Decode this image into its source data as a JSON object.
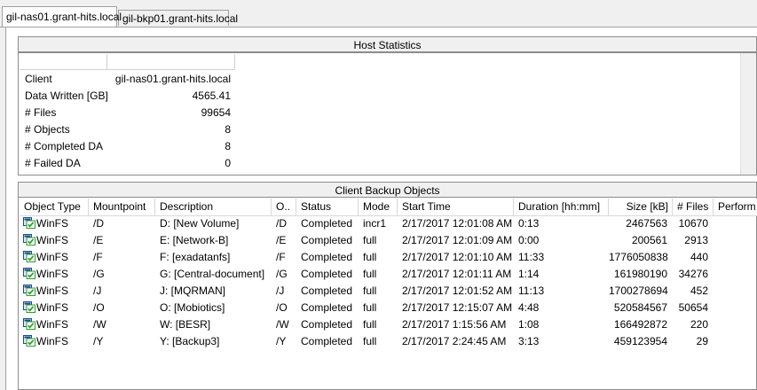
{
  "tabs": [
    {
      "label": "gil-nas01.grant-hits.local",
      "active": true
    },
    {
      "label": "gil-bkp01.grant-hits.local",
      "active": false
    }
  ],
  "host_statistics": {
    "title": "Host Statistics",
    "rows": [
      {
        "label": "Client",
        "value": "gil-nas01.grant-hits.local"
      },
      {
        "label": "Data Written [GB]",
        "value": "4565.41"
      },
      {
        "label": "# Files",
        "value": "99654"
      },
      {
        "label": "# Objects",
        "value": "8"
      },
      {
        "label": "# Completed DA",
        "value": "8"
      },
      {
        "label": "# Failed DA",
        "value": "0"
      }
    ]
  },
  "client_backup_objects": {
    "title": "Client Backup Objects",
    "columns": [
      "Object Type",
      "Mountpoint",
      "Description",
      "O..",
      "Status",
      "Mode",
      "Start Time",
      "Duration [hh:mm]",
      "Size [kB]",
      "# Files",
      "Perform"
    ],
    "rows": [
      {
        "object_type": "WinFS",
        "mountpoint": "/D",
        "description": "D: [New Volume]",
        "o": "/D",
        "status": "Completed",
        "mode": "incr1",
        "start_time": "2/17/2017 12:01:08 AM",
        "duration": "0:13",
        "size": "2467563",
        "files": "10670"
      },
      {
        "object_type": "WinFS",
        "mountpoint": "/E",
        "description": "E: [Network-B]",
        "o": "/E",
        "status": "Completed",
        "mode": "full",
        "start_time": "2/17/2017 12:01:09 AM",
        "duration": "0:00",
        "size": "200561",
        "files": "2913"
      },
      {
        "object_type": "WinFS",
        "mountpoint": "/F",
        "description": "F: [exadatanfs]",
        "o": "/F",
        "status": "Completed",
        "mode": "full",
        "start_time": "2/17/2017 12:01:10 AM",
        "duration": "11:33",
        "size": "1776050838",
        "files": "440"
      },
      {
        "object_type": "WinFS",
        "mountpoint": "/G",
        "description": "G: [Central-document]",
        "o": "/G",
        "status": "Completed",
        "mode": "full",
        "start_time": "2/17/2017 12:01:11 AM",
        "duration": "1:14",
        "size": "161980190",
        "files": "34276"
      },
      {
        "object_type": "WinFS",
        "mountpoint": "/J",
        "description": "J: [MQRMAN]",
        "o": "/J",
        "status": "Completed",
        "mode": "full",
        "start_time": "2/17/2017 12:01:52 AM",
        "duration": "11:13",
        "size": "1700278694",
        "files": "452"
      },
      {
        "object_type": "WinFS",
        "mountpoint": "/O",
        "description": "O: [Mobiotics]",
        "o": "/O",
        "status": "Completed",
        "mode": "full",
        "start_time": "2/17/2017 12:15:07 AM",
        "duration": "4:48",
        "size": "520584567",
        "files": "50654"
      },
      {
        "object_type": "WinFS",
        "mountpoint": "/W",
        "description": "W: [BESR]",
        "o": "/W",
        "status": "Completed",
        "mode": "full",
        "start_time": "2/17/2017 1:15:56 AM",
        "duration": "1:08",
        "size": "166492872",
        "files": "220"
      },
      {
        "object_type": "WinFS",
        "mountpoint": "/Y",
        "description": "Y: [Backup3]",
        "o": "/Y",
        "status": "Completed",
        "mode": "full",
        "start_time": "2/17/2017 2:24:45 AM",
        "duration": "3:13",
        "size": "459123954",
        "files": "29"
      }
    ]
  },
  "icons": {
    "object_type": "winfs-object-icon"
  },
  "colors": {
    "icon_green": "#2e9e2e",
    "icon_back": "#1e4e8c"
  }
}
